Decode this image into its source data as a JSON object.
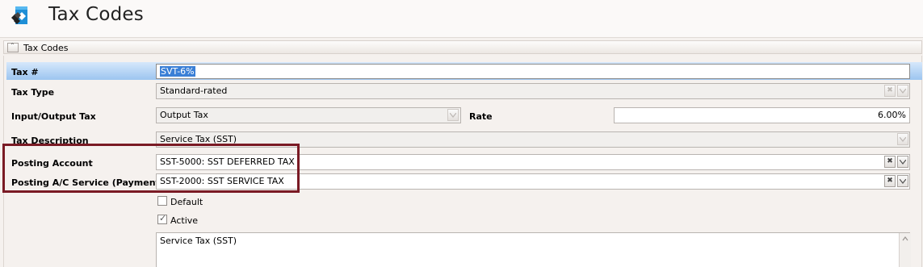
{
  "header": {
    "title": "Tax Codes",
    "icon": "tax-codes-diamond-icon"
  },
  "section": {
    "label": "Tax Codes",
    "collapse_icon": "chevron-up-icon"
  },
  "form": {
    "tax_no": {
      "label": "Tax #",
      "value": "SVT-6%"
    },
    "tax_type": {
      "label": "Tax Type",
      "value": "Standard-rated"
    },
    "io_tax": {
      "label": "Input/Output Tax",
      "value": "Output Tax"
    },
    "rate": {
      "label": "Rate",
      "value": "6.00%"
    },
    "tax_description": {
      "label": "Tax Description",
      "value": "Service Tax (SST)"
    },
    "posting_account": {
      "label": "Posting Account",
      "value": "SST-5000: SST DEFERRED TAX"
    },
    "posting_ac_service": {
      "label": "Posting A/C Service (Payment)",
      "value": "SST-2000: SST SERVICE TAX"
    },
    "default": {
      "label": "Default",
      "checked": false
    },
    "active": {
      "label": "Active",
      "checked": true
    },
    "notes": {
      "value": "Service Tax (SST)"
    }
  },
  "colors": {
    "highlight_row": "#9cc5f0",
    "annotation_border": "#7a1a24",
    "selection": "#3a7fd6"
  }
}
